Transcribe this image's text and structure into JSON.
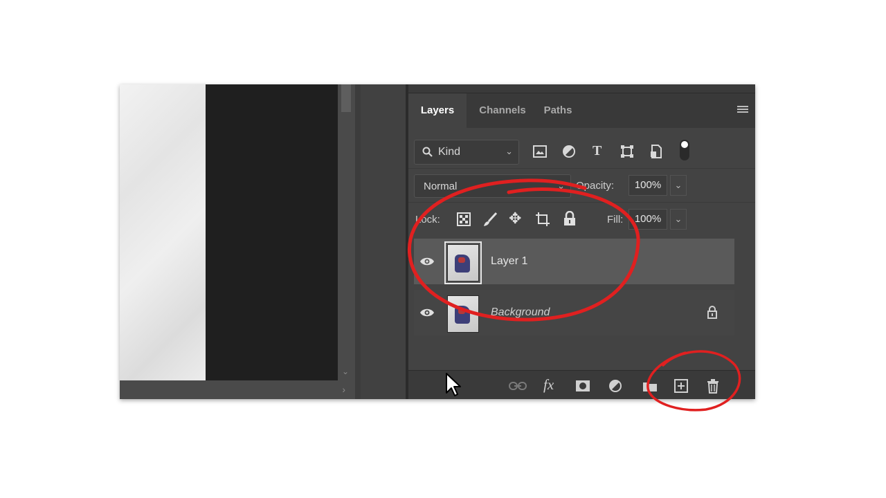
{
  "panel": {
    "tabs": [
      "Layers",
      "Channels",
      "Paths"
    ],
    "active_tab": "Layers",
    "filter": {
      "kind_label": "Kind"
    },
    "blend_mode": "Normal",
    "opacity_label": "Opacity:",
    "opacity_value": "100%",
    "lock_label": "Lock:",
    "fill_label": "Fill:",
    "fill_value": "100%",
    "layers": [
      {
        "name": "Layer 1",
        "selected": true,
        "locked": false
      },
      {
        "name": "Background",
        "selected": false,
        "locked": true
      }
    ]
  },
  "colors": {
    "annotation": "#e02020",
    "panel_bg": "#434343",
    "selected_layer": "#5a5a5a"
  },
  "icons": {
    "filter": [
      "image-filter-icon",
      "adjustment-filter-icon",
      "type-filter-icon",
      "shape-filter-icon",
      "smart-object-filter-icon"
    ],
    "lock": [
      "lock-transparent-pixels-icon",
      "lock-image-pixels-icon",
      "lock-position-icon",
      "lock-artboard-icon",
      "lock-all-icon"
    ],
    "bottom": [
      "link-layers-icon",
      "layer-style-fx-icon",
      "add-mask-icon",
      "adjustment-layer-icon",
      "new-group-icon",
      "new-layer-icon",
      "delete-layer-icon"
    ]
  }
}
